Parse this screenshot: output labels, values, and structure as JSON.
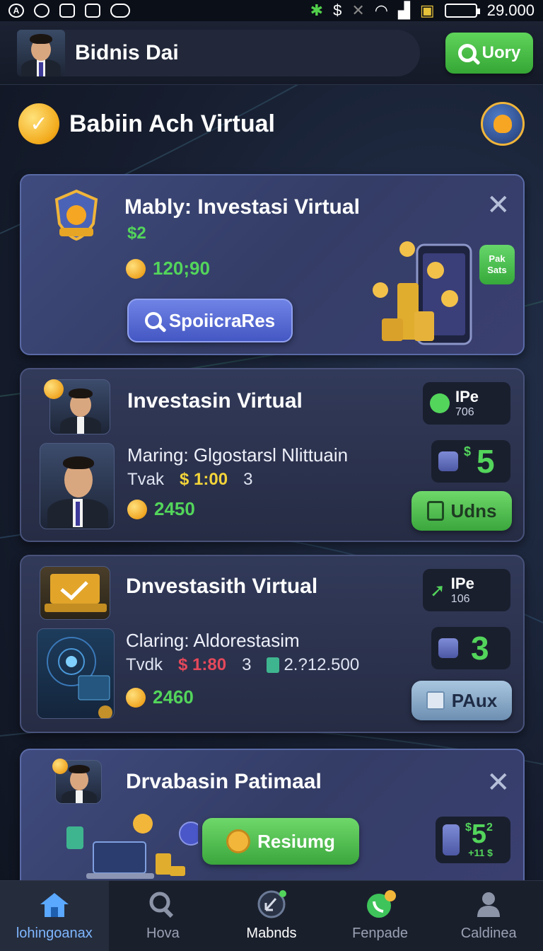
{
  "status_bar": {
    "time": "29.000",
    "currency_icon": "$"
  },
  "header": {
    "title": "Bidnis Dai",
    "search_label": "Uory"
  },
  "section": {
    "title": "Babiin Ach Virtual"
  },
  "featured_card": {
    "title": "Mably: Investasi Virtual",
    "price": "$2",
    "coins": "120;90",
    "button_label": "SpoiicrаRes",
    "bubble_label": "Pak Sats"
  },
  "card_one": {
    "title": "Investasin Virtual",
    "subtitle": "Maring: Glgostarsl Nlittuain",
    "meta_label": "Tvak",
    "meta_currency": "$",
    "meta_value": "1:00",
    "meta_count": "3",
    "coins": "2450",
    "stat_top_label": "IPe",
    "stat_top_sub": "706",
    "stat_price": "5",
    "stat_currency": "$",
    "button_label": "Udns"
  },
  "card_two": {
    "title": "Dnvestasith Virtual",
    "subtitle": "Claring: Aldorestasim",
    "meta_label": "Tvdk",
    "meta_currency": "$",
    "meta_value": "1:80",
    "meta_count": "3",
    "meta_extra": "2.?12.500",
    "coins": "2460",
    "stat_top_label": "IPe",
    "stat_top_sub": "106",
    "stat_price": "3",
    "button_label": "PAux"
  },
  "card_three": {
    "title": "Drvabasin Patimaal",
    "button_label": "Resiumg",
    "stat_price": "5",
    "stat_currency": "$",
    "stat_super": "2",
    "stat_sub": "+11 $"
  },
  "bottom_nav": [
    {
      "label": "lohingoanax",
      "icon": "home-icon"
    },
    {
      "label": "Hova",
      "icon": "search-icon"
    },
    {
      "label": "Mabnds",
      "icon": "trend-icon"
    },
    {
      "label": "Fenpade",
      "icon": "phone-icon"
    },
    {
      "label": "Caldinea",
      "icon": "user-icon"
    }
  ],
  "colors": {
    "accent_green": "#53d55b",
    "accent_blue": "#4457c3",
    "background": "#161d2e"
  }
}
